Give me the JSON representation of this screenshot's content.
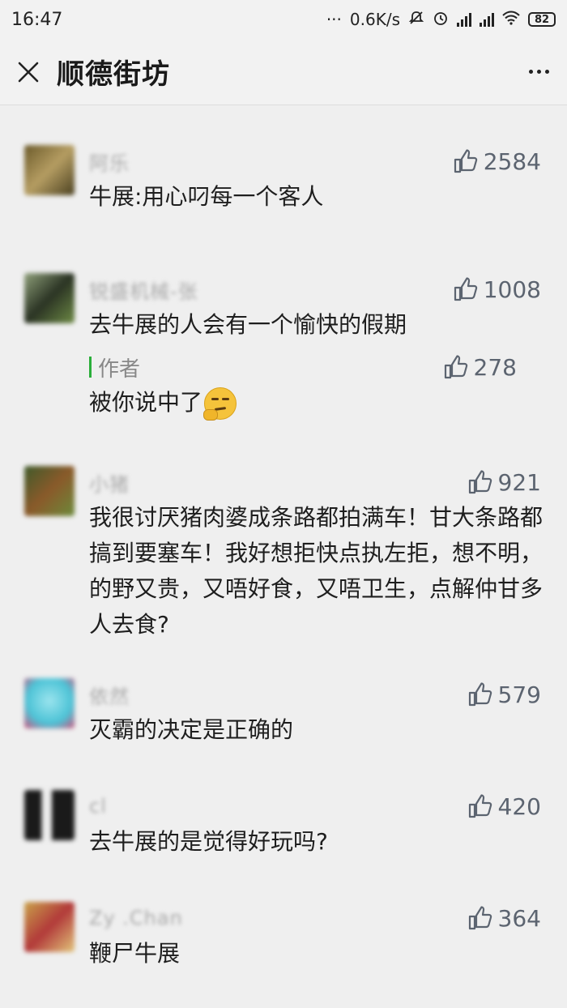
{
  "status_bar": {
    "time": "16:47",
    "network_speed": "0.6K/s",
    "battery": "82",
    "dots": "···"
  },
  "title_bar": {
    "title": "顺德街坊"
  },
  "like_icon": "thumbs-up-icon",
  "author_tag": "作者",
  "colors": {
    "background": "#efefef",
    "likes_text": "#5c6470",
    "author_accent": "#2aae3a"
  },
  "comments": [
    {
      "username": "阿乐",
      "likes": "2584",
      "text": "牛展:用心叼每一个客人",
      "avatar_color": "#7a6a3c"
    },
    {
      "username": "锐盛机械-张",
      "likes": "1008",
      "text": "去牛展的人会有一个愉快的假期",
      "avatar_color": "#4a5a3a",
      "reply": {
        "likes": "278",
        "text": "被你说中了"
      }
    },
    {
      "username": "小猪",
      "likes": "921",
      "text": "我很讨厌猪肉婆成条路都拍满车！甘大条路都搞到要塞车！我好想拒快点执左拒，想不明，的野又贵，又唔好食，又唔卫生，点解仲甘多人去食?",
      "avatar_color": "#5a6a3a"
    },
    {
      "username": "依然",
      "likes": "579",
      "text": "灭霸的决定是正确的",
      "avatar_color": "#5fc7d8"
    },
    {
      "username": "cl",
      "likes": "420",
      "text": "去牛展的是觉得好玩吗?",
      "avatar_color": "#1c1c1c"
    },
    {
      "username": "Zy .Chan",
      "likes": "364",
      "text": "鞭尸牛展",
      "avatar_color": "#c9a24a"
    }
  ]
}
